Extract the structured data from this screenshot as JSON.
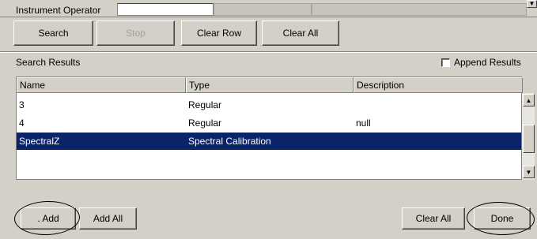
{
  "top": {
    "operator_label": "Instrument Operator",
    "operator_value": ""
  },
  "toolbar": {
    "search": "Search",
    "stop": "Stop",
    "clear_row": "Clear Row",
    "clear_all": "Clear All"
  },
  "results": {
    "title": "Search Results",
    "append_label": "Append Results",
    "append_checked": false,
    "columns": [
      "Name",
      "Type",
      "Description"
    ],
    "rows": [
      {
        "name": "3",
        "type": "Regular",
        "description": ""
      },
      {
        "name": "4",
        "type": "Regular",
        "description": "null"
      },
      {
        "name": "SpectralZ",
        "type": "Spectral Calibration",
        "description": "",
        "selected": true
      }
    ]
  },
  "footer": {
    "add": ". Add",
    "add_all": "Add All",
    "clear_all": "Clear All",
    "done": "Done"
  },
  "colors": {
    "background": "#d4d0c8",
    "selection": "#0a246a"
  }
}
